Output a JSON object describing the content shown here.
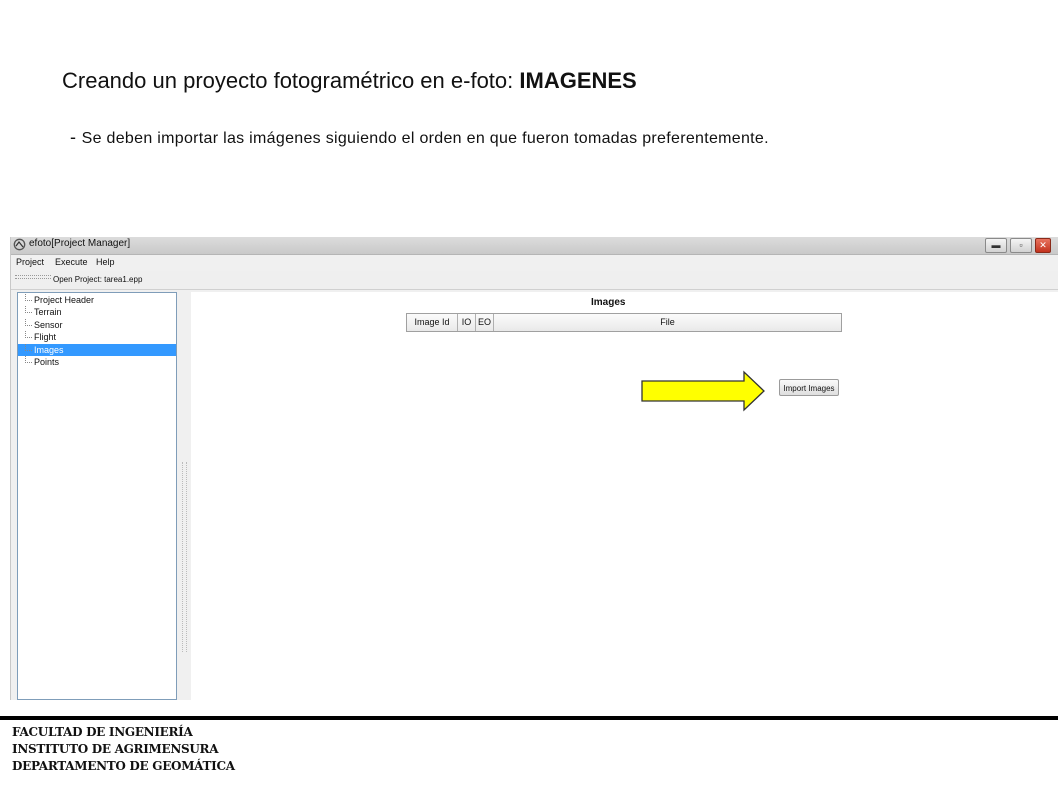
{
  "slide": {
    "title_prefix": "Creando un proyecto fotogramétrico en e-foto: ",
    "title_bold": "IMAGENES",
    "bullet_dash": "- ",
    "bullet_text": "Se deben importar las imágenes siguiendo el orden en que fueron tomadas preferentemente."
  },
  "window": {
    "title": "efoto[Project Manager]",
    "buttons": {
      "minimize": "▬",
      "maximize": "▫",
      "close": "✕"
    }
  },
  "menubar": {
    "project": "Project",
    "execute": "Execute",
    "help": "Help"
  },
  "toolbar": {
    "open_project": "Open Project: tarea1.epp"
  },
  "tree": {
    "items": [
      "Project Header",
      "Terrain",
      "Sensor",
      "Flight",
      "Images",
      "Points"
    ],
    "selected": "Images"
  },
  "images_panel": {
    "heading": "Images",
    "columns": [
      "Image Id",
      "IO",
      "EO",
      "File"
    ],
    "import_button": "Import Images"
  },
  "annotation": {
    "arrow_color": "#ffff00"
  },
  "footer": {
    "line1": "FACULTAD DE INGENIERÍA",
    "line2": "INSTITUTO DE AGRIMENSURA",
    "line3": "DEPARTAMENTO DE GEOMÁTICA"
  }
}
